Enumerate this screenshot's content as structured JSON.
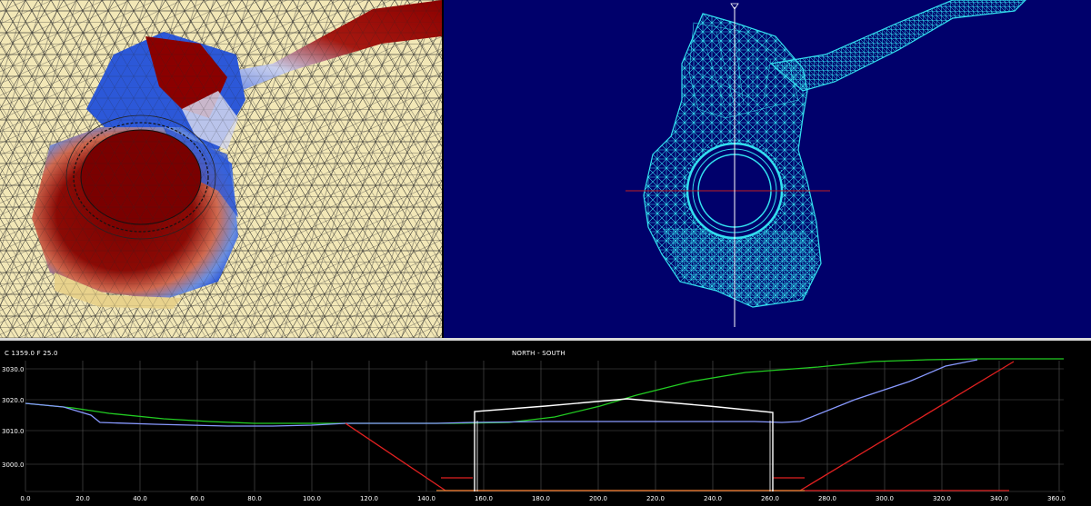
{
  "section": {
    "left_info": "C 1359.0   F 25.0",
    "title": "NORTH - SOUTH",
    "x_ticks": [
      "0.0",
      "20.0",
      "40.0",
      "60.0",
      "80.0",
      "100.0",
      "120.0",
      "140.0",
      "160.0",
      "180.0",
      "200.0",
      "220.0",
      "240.0",
      "260.0",
      "280.0",
      "300.0",
      "320.0",
      "340.0",
      "360.0"
    ],
    "y_ticks": [
      "3000.0",
      "3010.0",
      "3020.0",
      "3030.0"
    ]
  },
  "colors": {
    "plan_bg": "#00006b",
    "mesh": "#33e0f0",
    "ground_green": "#22cc22",
    "ground_blue": "#8899ff",
    "design_red": "#e02020",
    "structure_white": "#ffffff",
    "grid": "#555555"
  },
  "icons": [
    "north-arrow-icon"
  ]
}
